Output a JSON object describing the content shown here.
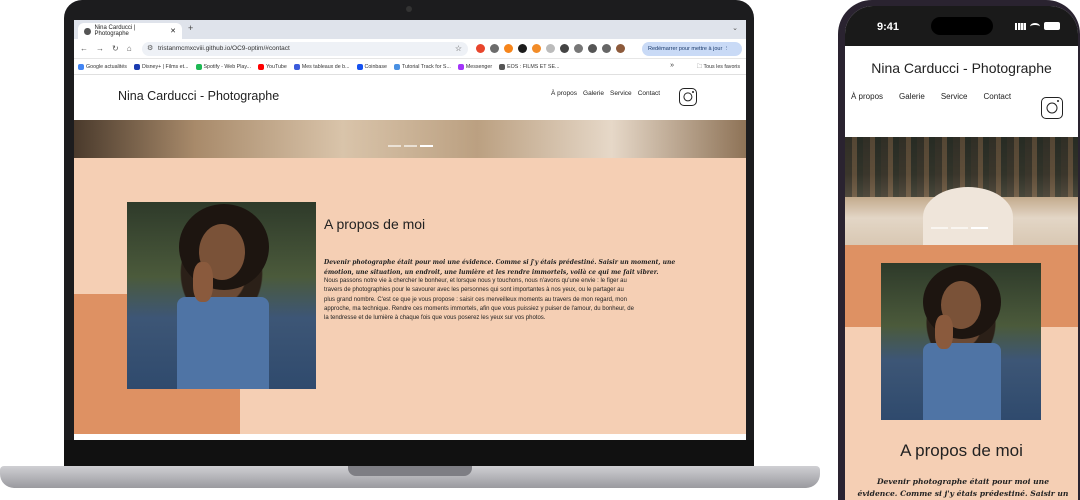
{
  "browser": {
    "tab_title": "Nina Carducci | Photographe",
    "url": "tristanmcmxcviii.github.io/OC9-optim/#contact",
    "relaunch_label": "Redémarrer pour mettre à jour",
    "bookmarks": [
      {
        "label": "Google actualités",
        "color": "#4285f4"
      },
      {
        "label": "Disney+ | Films et...",
        "color": "#1a3bb0"
      },
      {
        "label": "Spotify - Web Play...",
        "color": "#1db954"
      },
      {
        "label": "YouTube",
        "color": "#ff0000"
      },
      {
        "label": "Mes tableaux de b...",
        "color": "#3b5bdb"
      },
      {
        "label": "Coinbase",
        "color": "#1652f0"
      },
      {
        "label": "Tutorial Track for S...",
        "color": "#4a90e2"
      },
      {
        "label": "Messenger",
        "color": "#a334fa"
      },
      {
        "label": "EOS : FILMS ET SE...",
        "color": "#555555"
      }
    ],
    "all_bookmarks_label": "Tous les favoris"
  },
  "site": {
    "logo": "Nina Carducci - Photographe",
    "nav": [
      "À propos",
      "Galerie",
      "Service",
      "Contact"
    ],
    "about": {
      "title": "A propos de moi",
      "lead": "Devenir photographe était pour moi une évidence. Comme si j'y étais prédestiné. Saisir un moment, une émotion, une situation, un endroit, une lumière et les rendre immortels, voilà ce qui me fait vibrer.",
      "body": "Nous passons notre vie à chercher le bonheur, et lorsque nous y touchons, nous n'avons qu'une envie : le figer au travers de photographies pour le savourer avec les personnes qui sont importantes à nos yeux, ou le partager au plus grand nombre. C'est ce que je vous propose : saisir ces merveilleux moments au travers de mon regard, mon approche, ma technique. Rendre ces moments immortels, afin que vous puissiez y puiser de l'amour, du bonheur, de la tendresse et de lumière à chaque fois que vous poserez les yeux sur vos photos.",
      "phone_lead": "Devenir photographe était pour moi une évidence. Comme si j'y étais prédestiné. Saisir un mom"
    },
    "colors": {
      "peach": "#f5cfb4",
      "orange": "#de9163"
    }
  },
  "phone": {
    "time": "9:41"
  }
}
